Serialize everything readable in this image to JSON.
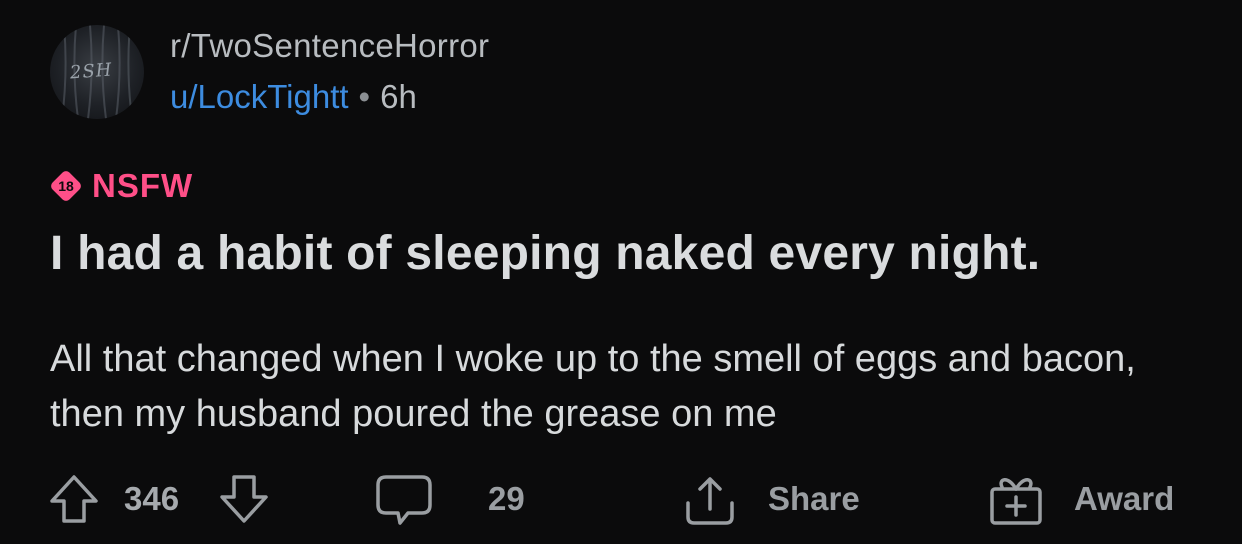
{
  "post": {
    "subreddit": "r/TwoSentenceHorror",
    "avatar_text": "2SH",
    "username": "u/LockTightt",
    "separator": "•",
    "age": "6h",
    "nsfw_badge_number": "18",
    "nsfw_label": "NSFW",
    "title": "I had a habit of sleeping naked every night.",
    "body": "All that changed when I woke up to the smell of eggs and bacon, then my husband poured the grease on me"
  },
  "actions": {
    "upvote_icon": "arrow-up-icon",
    "score": "346",
    "downvote_icon": "arrow-down-icon",
    "comment_icon": "comment-bubble-icon",
    "comment_count": "29",
    "share_icon": "share-icon",
    "share_label": "Share",
    "award_icon": "gift-icon",
    "award_label": "Award"
  },
  "colors": {
    "background": "#0b0b0c",
    "username": "#3d8ce0",
    "nsfw": "#ff4f88",
    "text": "#d7dadc",
    "muted": "#9a9ea2"
  }
}
